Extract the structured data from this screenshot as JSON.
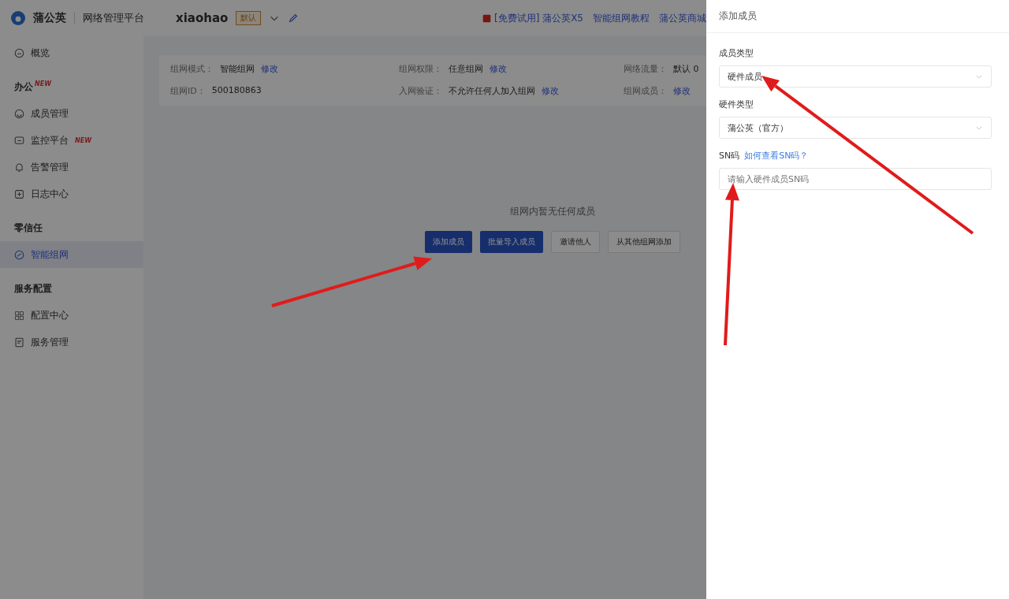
{
  "header": {
    "brand": "蒲公英",
    "product": "网络管理平台",
    "network_name": "xiaohao",
    "network_tag": "默认",
    "links": [
      {
        "text": "[免费试用] 蒲公英X5",
        "kind": "promo"
      },
      {
        "text": "智能组网教程",
        "kind": "link"
      },
      {
        "text": "蒲公英商城",
        "kind": "link"
      }
    ]
  },
  "sidebar": [
    {
      "kind": "item",
      "label": "概览",
      "selected": false
    },
    {
      "kind": "heading",
      "label": "办公",
      "badge": "NEW"
    },
    {
      "kind": "item",
      "label": "成员管理",
      "selected": false
    },
    {
      "kind": "item",
      "label": "监控平台",
      "selected": false,
      "badge": "NEW"
    },
    {
      "kind": "item",
      "label": "告警管理",
      "selected": false
    },
    {
      "kind": "item",
      "label": "日志中心",
      "selected": false
    },
    {
      "kind": "heading",
      "label": "零信任"
    },
    {
      "kind": "item",
      "label": "智能组网",
      "selected": true
    },
    {
      "kind": "heading",
      "label": "服务配置"
    },
    {
      "kind": "item",
      "label": "配置中心",
      "selected": false
    },
    {
      "kind": "item",
      "label": "服务管理",
      "selected": false
    }
  ],
  "info": [
    [
      {
        "label": "组网模式：",
        "value": "智能组网",
        "link": "修改"
      },
      {
        "label": "组网权限：",
        "value": "任意组网",
        "link": "修改"
      },
      {
        "label": "网络流量：",
        "value": "默认 0"
      }
    ],
    [
      {
        "label": "组网ID：",
        "value": "500180863"
      },
      {
        "label": "入网验证：",
        "value": "不允许任何人加入组网",
        "link": "修改"
      },
      {
        "label": "组网成员：",
        "link": "修改"
      }
    ]
  ],
  "empty": {
    "message": "组网内暂无任何成员",
    "buttons": [
      {
        "label": "添加成员",
        "kind": "primary"
      },
      {
        "label": "批量导入成员",
        "kind": "primary"
      },
      {
        "label": "邀请他人",
        "kind": "plain"
      },
      {
        "label": "从其他组网添加",
        "kind": "plain"
      }
    ]
  },
  "drawer": {
    "title": "添加成员",
    "fields": [
      {
        "kind": "select",
        "label": "成员类型",
        "value": "硬件成员"
      },
      {
        "kind": "select",
        "label": "硬件类型",
        "value": "蒲公英（官方）"
      },
      {
        "kind": "input",
        "label": "SN码",
        "help": "如何查看SN码？",
        "placeholder": "请输入硬件成员SN码"
      }
    ]
  }
}
